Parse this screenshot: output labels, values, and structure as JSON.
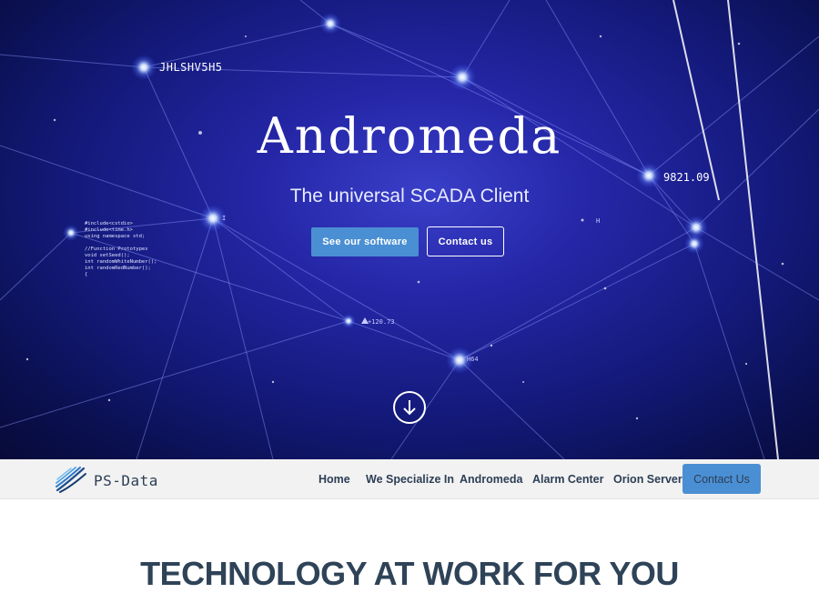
{
  "hero": {
    "title": "Andromeda",
    "subtitle": "The universal SCADA Client",
    "primary_button": "See our software",
    "secondary_button": "Contact us",
    "labels": {
      "node_id": "JHLSHV5H5",
      "node_value": "9821.09",
      "small_value": "+120.73",
      "small_tag": "H64",
      "tick_a": "I",
      "tick_b": "H"
    },
    "code_snippet": "#include<cstdio>\n#include<time.h>\nusing namespace std;\n\n//Function Prototypes\nvoid setSeed();\nint randomWhiteNumber();\nint randomRedNumber();\n{"
  },
  "navbar": {
    "brand": "PS-Data",
    "items": [
      {
        "label": "Home"
      },
      {
        "label": "We Specialize In"
      },
      {
        "label": "Andromeda"
      },
      {
        "label": "Alarm Center"
      },
      {
        "label": "Orion Server"
      }
    ],
    "cta": "Contact Us"
  },
  "section": {
    "title": "TECHNOLOGY AT WORK FOR YOU"
  },
  "colors": {
    "accent": "#4a8fd3",
    "text_dark": "#2c3e55",
    "hero_bg": "#1c2092"
  },
  "icons": {
    "logo": "ps-data-logo-icon",
    "scroll": "arrow-down-circle-icon"
  }
}
